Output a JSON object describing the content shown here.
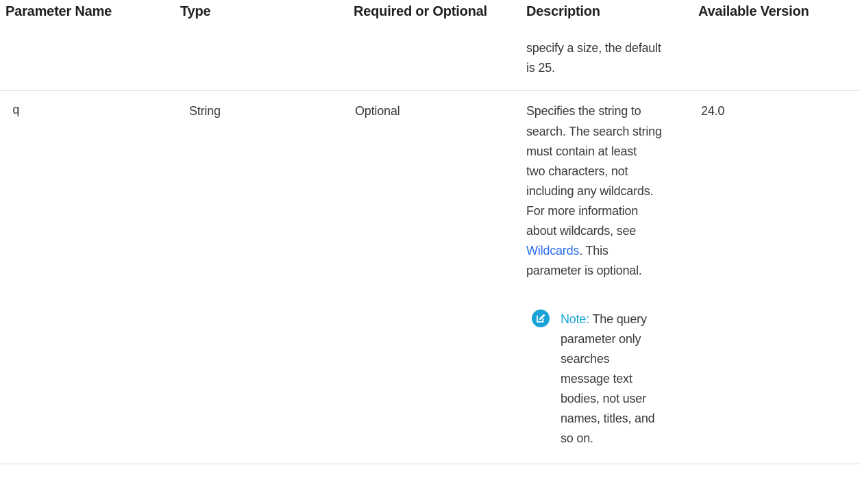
{
  "table": {
    "headers": {
      "param_name": "Parameter Name",
      "type": "Type",
      "required": "Required or Optional",
      "description": "Description",
      "version": "Available Version"
    },
    "prev_row": {
      "desc_lines": [
        "specify a size, the default",
        "is 25."
      ]
    },
    "row_q": {
      "name": "q",
      "type": "String",
      "required": "Optional",
      "version": "24.0",
      "desc_lines": [
        "Specifies the string to",
        "search. The search string",
        "must contain at least",
        "two characters, not",
        "including any wildcards.",
        "For more information",
        "about wildcards, see"
      ],
      "link_text": "Wildcards",
      "after_link": ". This",
      "desc_tail": "parameter is optional.",
      "note": {
        "label": "Note:",
        "first_line": " The query",
        "lines": [
          "parameter only",
          "searches",
          "message text",
          "bodies, not user",
          "names, titles, and",
          "so on."
        ]
      }
    }
  },
  "colors": {
    "link": "#2a6cf0",
    "note_accent": "#1aa3d8",
    "rule": "#dcdcdc"
  },
  "icons": {
    "note": "edit-note-icon"
  }
}
